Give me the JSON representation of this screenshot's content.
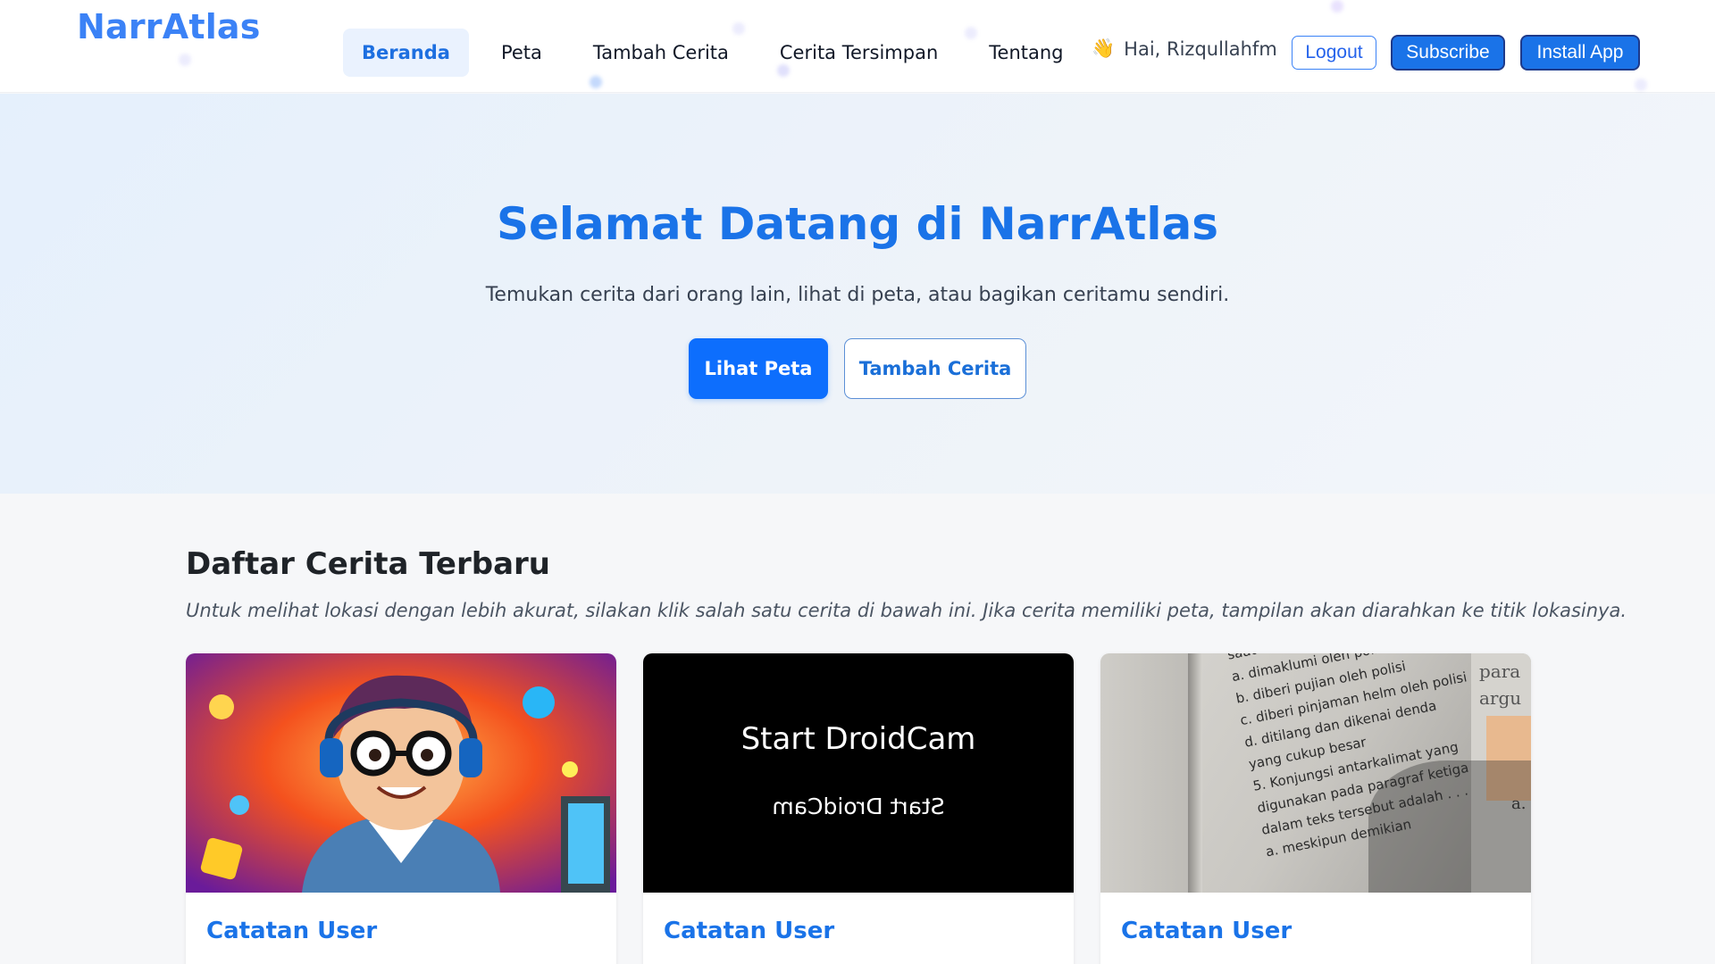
{
  "app": {
    "logo": "NarrAtlas"
  },
  "nav": {
    "items": [
      {
        "label": "Beranda",
        "active": true
      },
      {
        "label": "Peta",
        "active": false
      },
      {
        "label": "Tambah Cerita",
        "active": false
      },
      {
        "label": "Cerita Tersimpan",
        "active": false
      },
      {
        "label": "Tentang",
        "active": false
      }
    ]
  },
  "user": {
    "wave_icon": "👋",
    "greeting": "Hai, Rizqullahfm",
    "logout_label": "Logout",
    "subscribe_label": "Subscribe",
    "install_label": "Install App"
  },
  "hero": {
    "title": "Selamat Datang di NarrAtlas",
    "subtitle": "Temukan cerita dari orang lain, lihat di peta, atau bagikan ceritamu sendiri.",
    "primary_button": "Lihat Peta",
    "secondary_button": "Tambah Cerita"
  },
  "stories": {
    "title": "Daftar Cerita Terbaru",
    "note": "Untuk melihat lokasi dengan lebih akurat, silakan klik salah satu cerita di bawah ini. Jika cerita memiliki peta, tampilan akan diarahkan ke titik lokasinya.",
    "cards": [
      {
        "title": "Catatan User",
        "image": "cartoon-avatar-illustration"
      },
      {
        "title": "Catatan User",
        "image": "droidcam-screen",
        "image_text": "Start DroidCam",
        "image_text_mirrored": "Start DroidCam"
      },
      {
        "title": "Catatan User",
        "image": "textbook-photo",
        "image_lines": [
          "saat berkendara",
          "a. dimaklumi oleh polisi",
          "b. diberi pujian oleh polisi",
          "c. diberi pinjaman helm oleh polisi",
          "d. ditilang dan dikenai denda",
          "yang cukup besar",
          "5. Konjungsi antarkalimat yang",
          "digunakan pada paragraf ketiga",
          "dalam teks tersebut adalah . . . .",
          "a. meskipun demikian"
        ],
        "margin_lines": [
          "para",
          "argu",
          "a."
        ]
      }
    ]
  },
  "colors": {
    "primary": "#1a73e8",
    "button_primary": "#0d6efd",
    "hero_bg": "#e5f0fc"
  }
}
